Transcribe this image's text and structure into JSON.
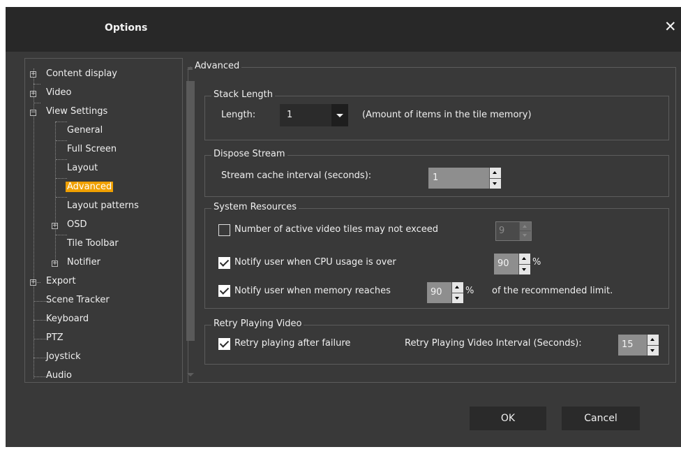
{
  "window": {
    "title": "Options",
    "close_label": "✕"
  },
  "tree": {
    "items": [
      {
        "label": "Content display"
      },
      {
        "label": "Video"
      },
      {
        "label": "View Settings"
      },
      {
        "label": "General"
      },
      {
        "label": "Full Screen"
      },
      {
        "label": "Layout"
      },
      {
        "label": "Advanced"
      },
      {
        "label": "Layout patterns"
      },
      {
        "label": "OSD"
      },
      {
        "label": "Tile Toolbar"
      },
      {
        "label": "Notifier"
      },
      {
        "label": "Export"
      },
      {
        "label": "Scene Tracker"
      },
      {
        "label": "Keyboard"
      },
      {
        "label": "PTZ"
      },
      {
        "label": "Joystick"
      },
      {
        "label": "Audio"
      }
    ],
    "selected": "Advanced"
  },
  "panel": {
    "title": "Advanced",
    "stack_length": {
      "legend": "Stack Length",
      "length_label": "Length:",
      "length_value": "1",
      "note": "(Amount of items in the tile memory)"
    },
    "dispose_stream": {
      "legend": "Dispose Stream",
      "interval_label": "Stream cache interval (seconds):",
      "interval_value": "1"
    },
    "system_resources": {
      "legend": "System Resources",
      "max_tiles_label": "Number of active video tiles may not exceed",
      "max_tiles_checked": false,
      "max_tiles_value": "9",
      "cpu_label": "Notify user when CPU usage is over",
      "cpu_checked": true,
      "cpu_value": "90",
      "cpu_unit": "%",
      "memory_label": "Notify user when memory reaches",
      "memory_checked": true,
      "memory_value": "90",
      "memory_unit": "%",
      "memory_suffix": "of the recommended limit."
    },
    "retry": {
      "legend": "Retry Playing Video",
      "retry_label": "Retry playing after failure",
      "retry_checked": true,
      "interval_label": "Retry Playing Video Interval (Seconds):",
      "interval_value": "15"
    }
  },
  "footer": {
    "ok_label": "OK",
    "cancel_label": "Cancel"
  },
  "colors": {
    "selection": "#f0a000",
    "dialog_bg": "#393939",
    "title_bg": "#282828"
  }
}
